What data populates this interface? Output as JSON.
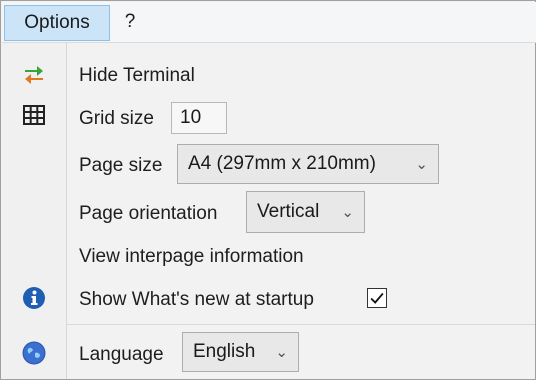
{
  "menubar": {
    "options_label": "Options",
    "help_label": "?"
  },
  "settings": {
    "hide_terminal_label": "Hide Terminal",
    "grid_size_label": "Grid size",
    "grid_size_value": "10",
    "page_size_label": "Page size",
    "page_size_value": "A4 (297mm x 210mm)",
    "page_orientation_label": "Page orientation",
    "page_orientation_value": "Vertical",
    "view_interpage_label": "View interpage information",
    "show_whats_new_label": "Show What's new at startup",
    "show_whats_new_checked": true,
    "language_label": "Language",
    "language_value": "English"
  },
  "icons": {
    "terminal": "swap-arrows-icon",
    "grid": "grid-icon",
    "info": "info-icon",
    "language": "globe-icon"
  },
  "colors": {
    "menu_selected_bg": "#cce4f7",
    "info_icon": "#1e5fb4",
    "swap_green": "#3aa43a",
    "swap_orange": "#e0781e"
  }
}
